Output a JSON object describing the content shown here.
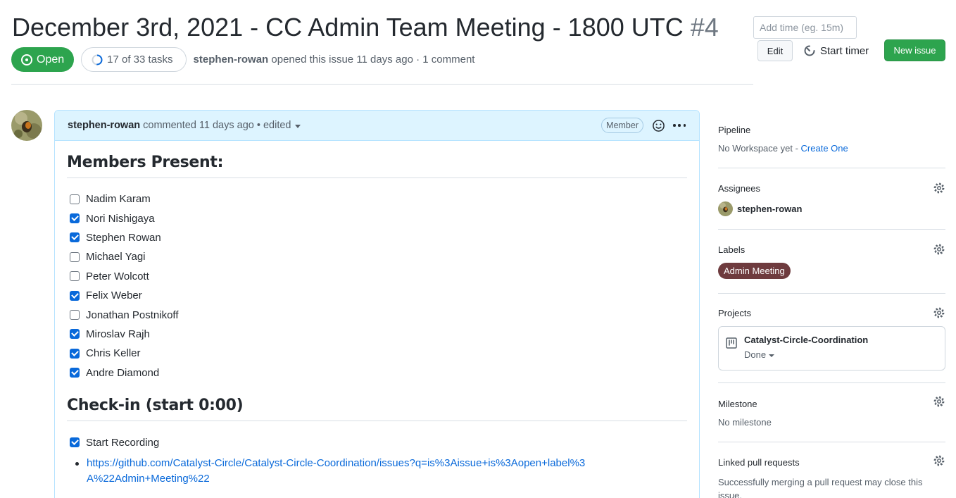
{
  "issue": {
    "title": "December 3rd, 2021 - CC Admin Team Meeting - 1800 UTC",
    "number": "#4",
    "state": "Open",
    "tasks_progress": "17 of 33 tasks",
    "tasks_done": 17,
    "tasks_total": 33,
    "author": "stephen-rowan",
    "opened_text": "opened this issue 11 days ago · 1 comment"
  },
  "actions": {
    "time_placeholder": "Add time (eg. 15m)",
    "edit_label": "Edit",
    "timer_label": "Start timer",
    "new_issue_label": "New issue"
  },
  "comment": {
    "author": "stephen-rowan",
    "meta": "commented 11 days ago • edited",
    "badge": "Member",
    "section1_heading": "Members Present:",
    "members": [
      {
        "name": "Nadim Karam",
        "checked": false
      },
      {
        "name": "Nori Nishigaya",
        "checked": true
      },
      {
        "name": "Stephen Rowan",
        "checked": true
      },
      {
        "name": "Michael Yagi",
        "checked": false
      },
      {
        "name": "Peter Wolcott",
        "checked": false
      },
      {
        "name": "Felix Weber",
        "checked": true
      },
      {
        "name": "Jonathan Postnikoff",
        "checked": false
      },
      {
        "name": "Miroslav Rajh",
        "checked": true
      },
      {
        "name": "Chris Keller",
        "checked": true
      },
      {
        "name": "Andre Diamond",
        "checked": true
      }
    ],
    "section2_heading": "Check-in (start 0:00)",
    "checkin": [
      {
        "name": "Start Recording",
        "checked": true
      }
    ],
    "link": "https://github.com/Catalyst-Circle/Catalyst-Circle-Coordination/issues?q=is%3Aissue+is%3Aopen+label%3A%22Admin+Meeting%22"
  },
  "sidebar": {
    "pipeline": {
      "title": "Pipeline",
      "text": "No Workspace yet - ",
      "link": "Create One"
    },
    "assignees": {
      "title": "Assignees",
      "user": "stephen-rowan"
    },
    "labels": {
      "title": "Labels",
      "label": "Admin Meeting",
      "label_color": "#6e3b3e"
    },
    "projects": {
      "title": "Projects",
      "name": "Catalyst-Circle-Coordination",
      "status": "Done"
    },
    "milestone": {
      "title": "Milestone",
      "text": "No milestone"
    },
    "linked_prs": {
      "title": "Linked pull requests",
      "text": "Successfully merging a pull request may close this issue."
    }
  },
  "colors": {
    "open_green": "#2da44e",
    "link_blue": "#0969da",
    "comment_header_bg": "#ddf4ff"
  }
}
